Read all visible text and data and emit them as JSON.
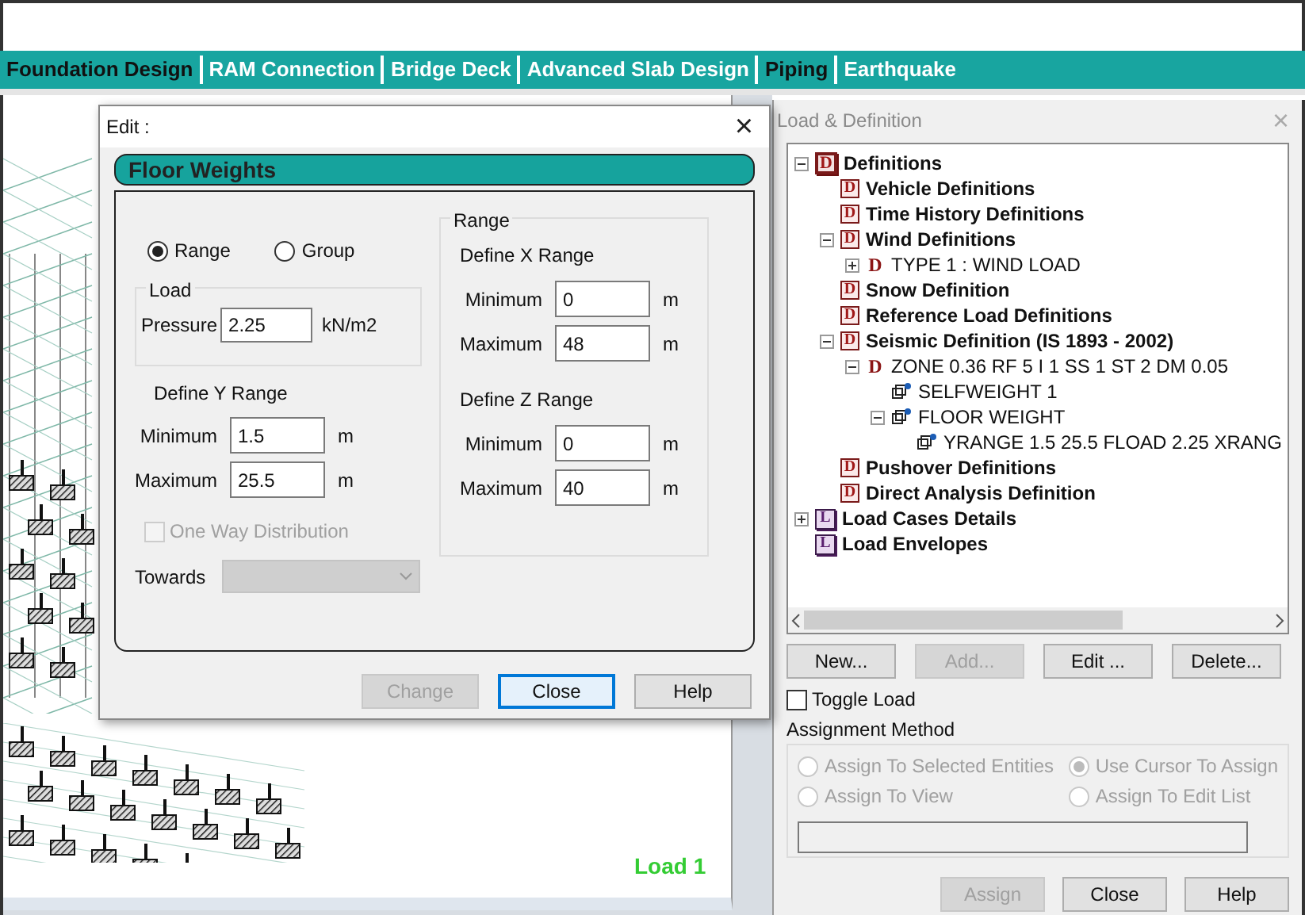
{
  "tabs": [
    {
      "label": "Foundation Design",
      "active": true
    },
    {
      "label": "RAM Connection",
      "active": false
    },
    {
      "label": "Bridge Deck",
      "active": false
    },
    {
      "label": "Advanced Slab Design",
      "active": false
    },
    {
      "label": "Piping",
      "active": true
    },
    {
      "label": "Earthquake",
      "active": false
    }
  ],
  "canvas": {
    "load_label": "Load 1"
  },
  "edit_dialog": {
    "title": "Edit :",
    "close": "×",
    "banner": "Floor Weights",
    "mode_options": [
      {
        "label": "Range",
        "selected": true
      },
      {
        "label": "Group",
        "selected": false
      }
    ],
    "load": {
      "title": "Load",
      "label": "Pressure",
      "value": "2.25",
      "unit": "kN/m2"
    },
    "y_range": {
      "title": "Define Y Range",
      "minimum": {
        "label": "Minimum",
        "value": "1.5",
        "unit": "m"
      },
      "maximum": {
        "label": "Maximum",
        "value": "25.5",
        "unit": "m"
      }
    },
    "range_group": {
      "title": "Range",
      "x_range": {
        "title": "Define X Range",
        "minimum": {
          "label": "Minimum",
          "value": "0",
          "unit": "m"
        },
        "maximum": {
          "label": "Maximum",
          "value": "48",
          "unit": "m"
        }
      },
      "z_range": {
        "title": "Define Z Range",
        "minimum": {
          "label": "Minimum",
          "value": "0",
          "unit": "m"
        },
        "maximum": {
          "label": "Maximum",
          "value": "40",
          "unit": "m"
        }
      }
    },
    "one_way": {
      "label": "One Way Distribution",
      "checked": false,
      "disabled": true
    },
    "towards": {
      "label": "Towards",
      "disabled": true
    },
    "buttons": [
      {
        "label": "Change",
        "disabled": true,
        "focused": false
      },
      {
        "label": "Close",
        "disabled": false,
        "focused": true
      },
      {
        "label": "Help",
        "disabled": false,
        "focused": false
      }
    ]
  },
  "load_panel": {
    "title": "Load & Definition",
    "close": "×",
    "tree": [
      {
        "label": "Definitions",
        "kind": "definitions",
        "icon": "D",
        "expanded": true,
        "children": [
          {
            "label": "Vehicle Definitions",
            "kind": "def",
            "icon": "D"
          },
          {
            "label": "Time History Definitions",
            "kind": "def",
            "icon": "D"
          },
          {
            "label": "Wind Definitions",
            "kind": "def",
            "icon": "D",
            "expanded": true,
            "children": [
              {
                "label": "TYPE 1 : WIND LOAD",
                "kind": "item",
                "icon": "D",
                "expanded": false
              }
            ]
          },
          {
            "label": "Snow Definition",
            "kind": "def",
            "icon": "D"
          },
          {
            "label": "Reference Load Definitions",
            "kind": "def",
            "icon": "D"
          },
          {
            "label": "Seismic Definition (IS 1893 - 2002)",
            "kind": "def",
            "icon": "D",
            "expanded": true,
            "children": [
              {
                "label": "ZONE 0.36 RF 5 I 1 SS 1 ST 2 DM 0.05",
                "kind": "item",
                "icon": "D",
                "expanded": true,
                "children": [
                  {
                    "label": "SELFWEIGHT 1",
                    "kind": "load"
                  },
                  {
                    "label": "FLOOR WEIGHT",
                    "kind": "load",
                    "expanded": true,
                    "children": [
                      {
                        "label": "YRANGE 1.5 25.5 FLOAD 2.25 XRANG",
                        "kind": "load"
                      }
                    ]
                  }
                ]
              }
            ]
          },
          {
            "label": "Pushover Definitions",
            "kind": "def",
            "icon": "D"
          },
          {
            "label": "Direct Analysis Definition",
            "kind": "def",
            "icon": "D"
          }
        ]
      },
      {
        "label": "Load Cases Details",
        "kind": "loads",
        "icon": "L",
        "expanded": false
      },
      {
        "label": "Load Envelopes",
        "kind": "loads",
        "icon": "L"
      }
    ],
    "buttons": [
      {
        "label": "New...",
        "disabled": false
      },
      {
        "label": "Add...",
        "disabled": true
      },
      {
        "label": "Edit ...",
        "disabled": false
      },
      {
        "label": "Delete...",
        "disabled": false
      }
    ],
    "toggle_load": {
      "label": "Toggle Load",
      "checked": false
    },
    "assignment": {
      "title": "Assignment Method",
      "options": [
        {
          "label": "Assign To Selected Entities",
          "selected": false,
          "disabled": true
        },
        {
          "label": "Use Cursor To Assign",
          "selected": true,
          "disabled": true
        },
        {
          "label": "Assign To View",
          "selected": false,
          "disabled": true
        },
        {
          "label": "Assign To Edit List",
          "selected": false,
          "disabled": true
        }
      ]
    },
    "footer_buttons": [
      {
        "label": "Assign",
        "disabled": true
      },
      {
        "label": "Close",
        "disabled": false
      },
      {
        "label": "Help",
        "disabled": false
      }
    ]
  }
}
